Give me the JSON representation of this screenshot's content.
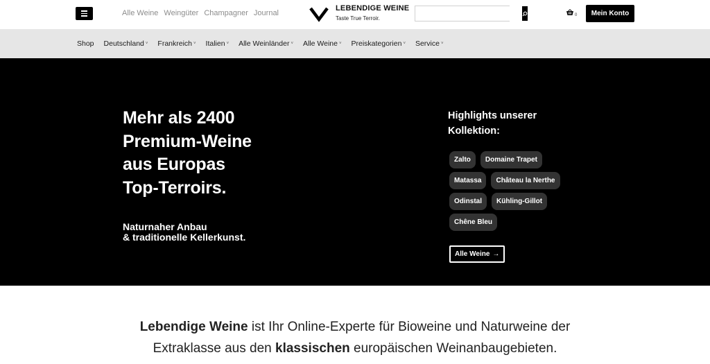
{
  "header": {
    "top_links": [
      "Alle Weine",
      "Weingüter",
      "Champagner",
      "Journal"
    ],
    "logo_title": "LEBENDIGE WEINE",
    "logo_tagline": "Taste True Terroir.",
    "search_placeholder": "",
    "cart_count": "0",
    "account_label": "Mein Konto"
  },
  "nav": {
    "items": [
      {
        "label": "Shop",
        "dropdown": false
      },
      {
        "label": "Deutschland",
        "dropdown": true
      },
      {
        "label": "Frankreich",
        "dropdown": true
      },
      {
        "label": "Italien",
        "dropdown": true
      },
      {
        "label": "Alle Weinländer",
        "dropdown": true
      },
      {
        "label": "Alle Weine",
        "dropdown": true
      },
      {
        "label": "Preiskategorien",
        "dropdown": true
      },
      {
        "label": "Service",
        "dropdown": true
      }
    ],
    "caret_glyph": "˅"
  },
  "hero": {
    "title_lines": [
      "Mehr als 2400",
      "Premium-Weine",
      "aus Europas",
      "Top-Terroirs."
    ],
    "subtitle_lines": [
      "Naturnaher Anbau",
      "& traditionelle Kellerkunst."
    ],
    "highlights_title_lines": [
      "Highlights unserer",
      "Kollektion:"
    ],
    "chip_rows": [
      [
        "Zalto",
        "Domaine Trapet"
      ],
      [
        "Matassa",
        "Château la Nerthe"
      ],
      [
        "Odinstal",
        "Kühling-Gillot"
      ],
      [
        "Chêne Bleu"
      ]
    ],
    "cta_label": "Alle Weine",
    "cta_arrow": "→"
  },
  "intro": {
    "brand": "Lebendige Weine",
    "text_1": " ist Ihr Online-Experte für Bioweine und Naturweine der",
    "text_2": "Extraklasse aus den ",
    "bold_word": "klassischen",
    "text_3": " europäischen Weinanbaugebieten."
  },
  "colors": {
    "hero_bg": "#000000",
    "nav_bg": "#e6e6e6",
    "chip_bg": "#333333",
    "top_link_color": "#8c8c8c"
  },
  "icons": {
    "menu": "hamburger-icon",
    "search": "search-icon",
    "cart": "basket-icon",
    "logo": "chevron-logo-icon"
  }
}
